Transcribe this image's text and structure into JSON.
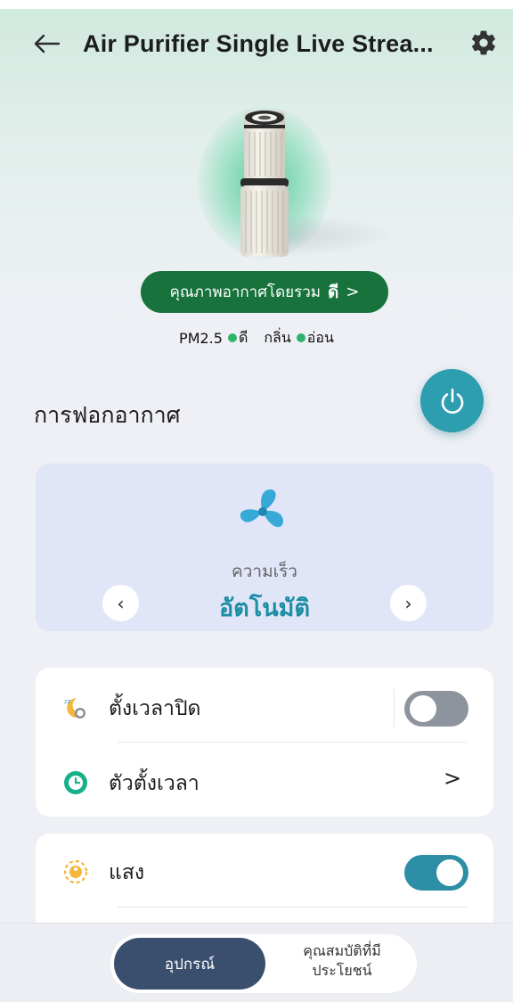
{
  "header": {
    "title": "Air Purifier Single Live Strea...",
    "back_icon": "arrow-left-icon",
    "settings_icon": "gear-icon"
  },
  "air_quality": {
    "label": "คุณภาพอากาศโดยรวม",
    "value": "ดี",
    "chevron": ">",
    "pm25_label": "PM2.5",
    "pm25_value": "ดี",
    "odor_label": "กลิ่น",
    "odor_value": "อ่อน",
    "status_color": "#2fb36b",
    "pill_color": "#17733b"
  },
  "purification": {
    "title": "การฟอกอากาศ",
    "power_icon": "power-icon",
    "power_color": "#2d9db0"
  },
  "fan": {
    "icon": "fan-icon",
    "speed_label": "ความเร็ว",
    "speed_value": "อัตโนมัติ",
    "prev": "‹",
    "next": "›"
  },
  "settings": {
    "sleep_timer": {
      "label": "ตั้งเวลาปิด",
      "icon": "sleep-moon-icon",
      "enabled": false
    },
    "timer": {
      "label": "ตัวตั้งเวลา",
      "icon": "clock-icon",
      "chevron": ">"
    },
    "light": {
      "label": "แสง",
      "icon": "light-bulb-icon",
      "enabled": true
    }
  },
  "bottom_tabs": {
    "device": "อุปกรณ์",
    "features_line1": "คุณสมบัติที่มี",
    "features_line2": "ประโยชน์",
    "active": "device"
  }
}
